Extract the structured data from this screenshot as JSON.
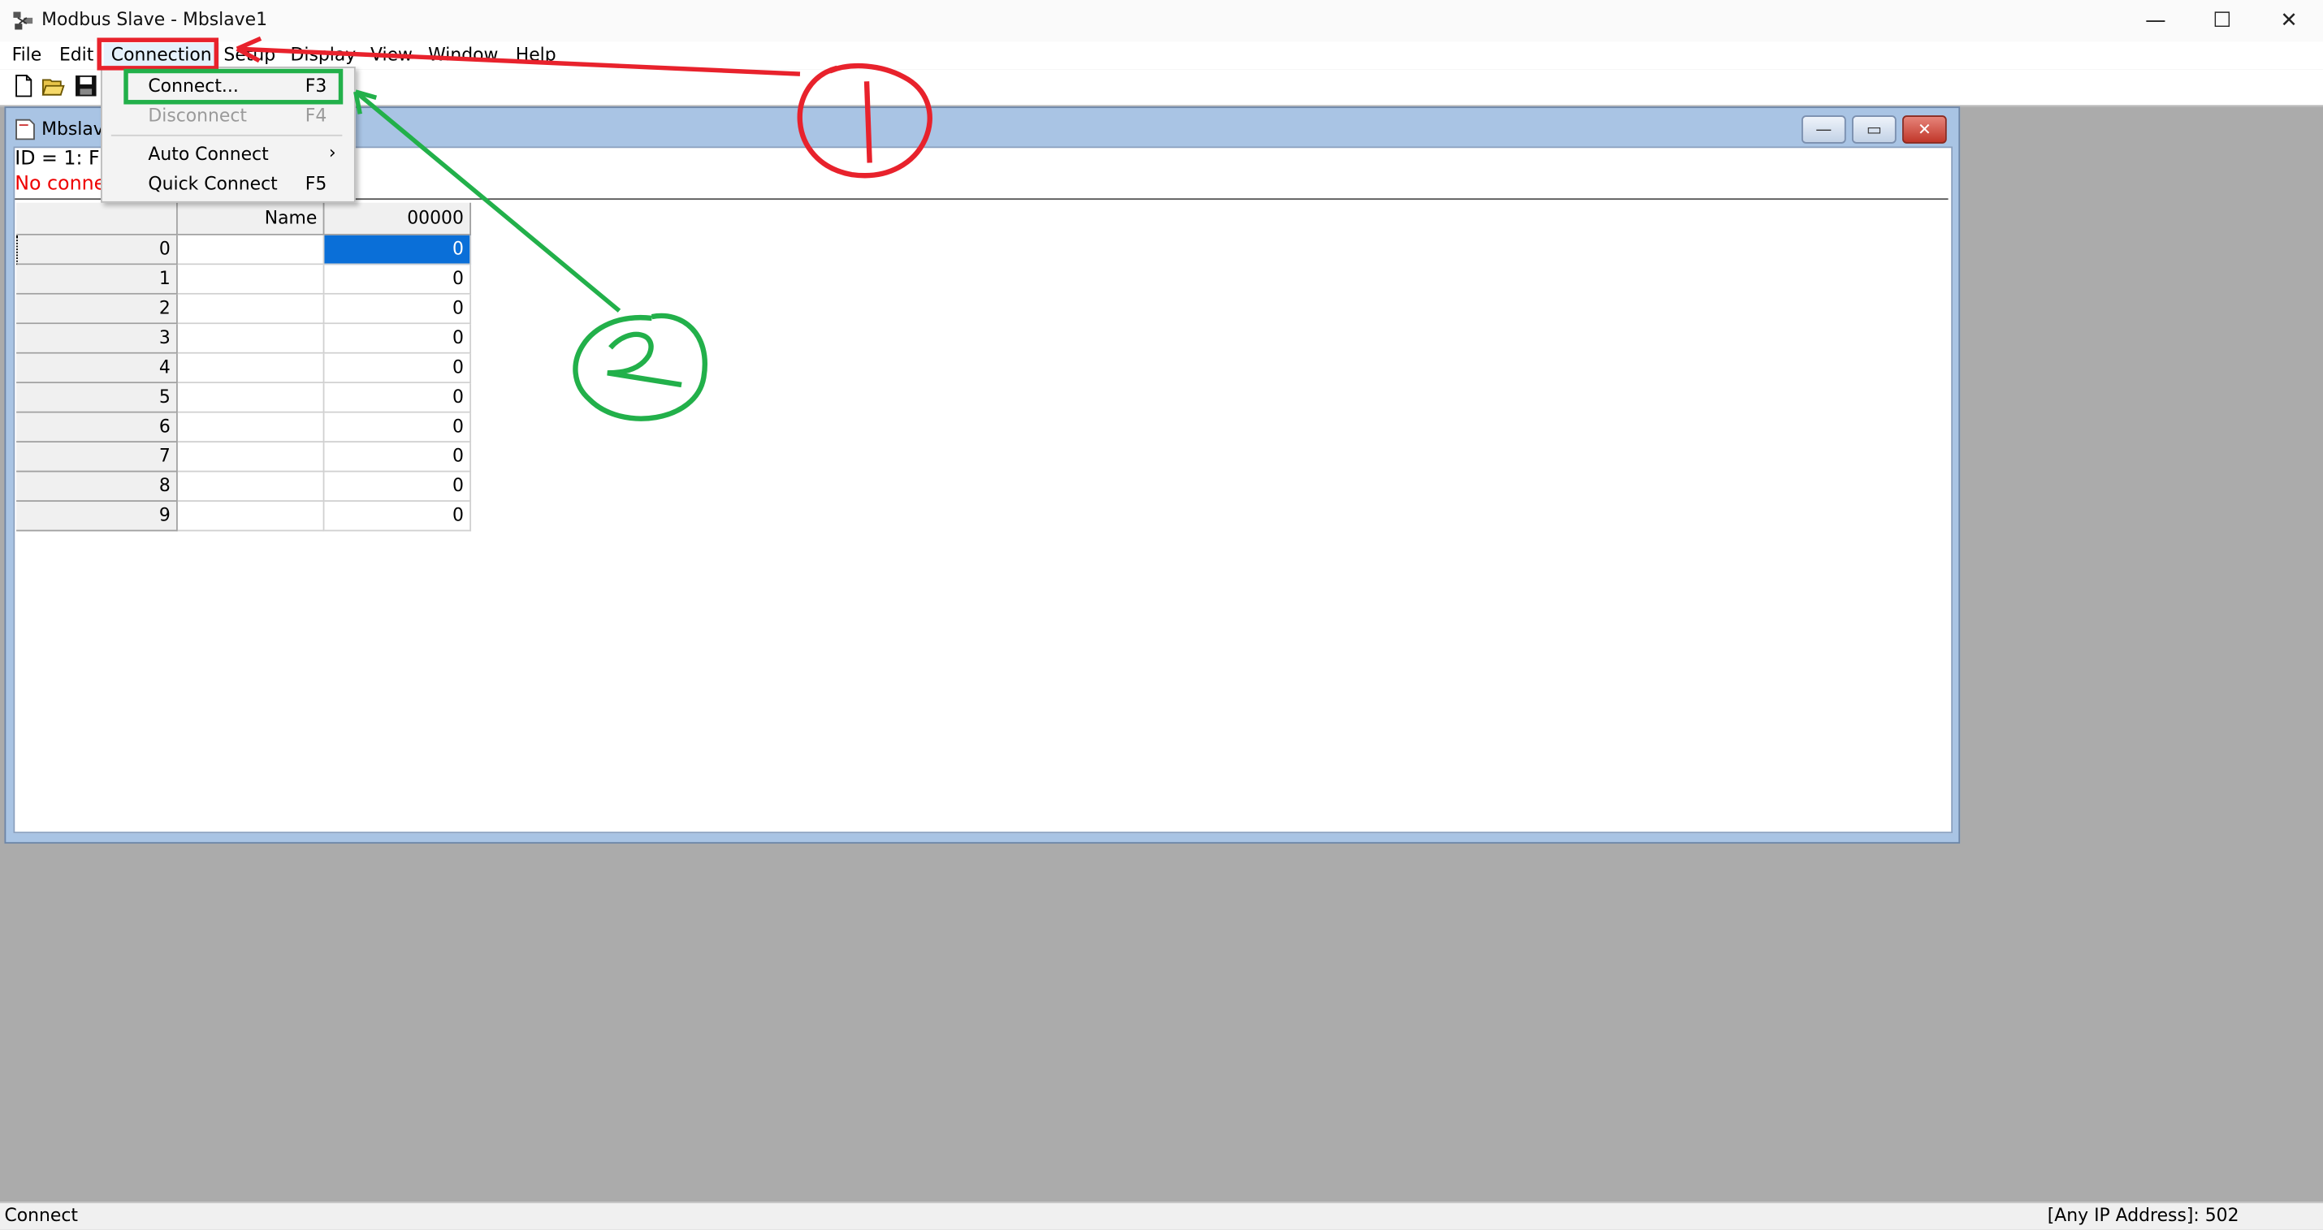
{
  "app": {
    "title": "Modbus Slave - Mbslave1",
    "controls": {
      "minimize": "—",
      "maximize": "☐",
      "close": "✕"
    }
  },
  "menubar": [
    "File",
    "Edit",
    "Connection",
    "Setup",
    "Display",
    "View",
    "Window",
    "Help"
  ],
  "connection_menu": {
    "items": [
      {
        "label": "Connect...",
        "shortcut": "F3",
        "enabled": true
      },
      {
        "label": "Disconnect",
        "shortcut": "F4",
        "enabled": false
      },
      {
        "label": "Auto Connect",
        "shortcut": "›",
        "enabled": true
      },
      {
        "label": "Quick Connect",
        "shortcut": "F5",
        "enabled": true
      }
    ]
  },
  "child_window": {
    "title": "Mbslav",
    "id_line": "ID = 1: F",
    "status": "No conne",
    "controls": {
      "minimize": "—",
      "restore": "▭",
      "close": "✕"
    }
  },
  "table": {
    "header_name": "Name",
    "header_address": "00000",
    "rows": [
      {
        "index": "0",
        "name": "",
        "value": "0"
      },
      {
        "index": "1",
        "name": "",
        "value": "0"
      },
      {
        "index": "2",
        "name": "",
        "value": "0"
      },
      {
        "index": "3",
        "name": "",
        "value": "0"
      },
      {
        "index": "4",
        "name": "",
        "value": "0"
      },
      {
        "index": "5",
        "name": "",
        "value": "0"
      },
      {
        "index": "6",
        "name": "",
        "value": "0"
      },
      {
        "index": "7",
        "name": "",
        "value": "0"
      },
      {
        "index": "8",
        "name": "",
        "value": "0"
      },
      {
        "index": "9",
        "name": "",
        "value": "0"
      }
    ]
  },
  "statusbar": {
    "left": "Connect",
    "right": "[Any IP Address]: 502"
  },
  "colors": {
    "highlight_red": "#e8222c",
    "highlight_green": "#22b04a",
    "selected_cell": "#0a6fd8"
  }
}
